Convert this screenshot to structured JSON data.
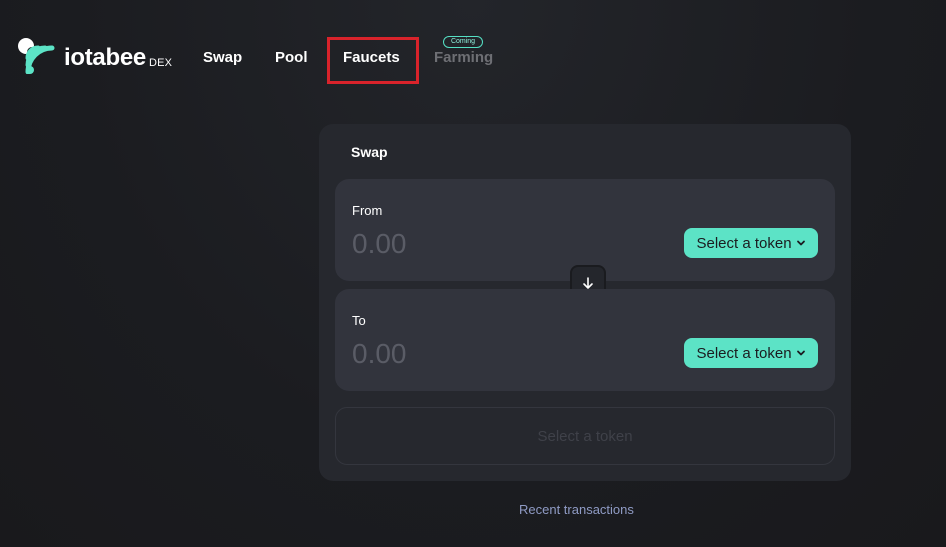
{
  "brand": {
    "name": "iotabee",
    "sub": "DEX",
    "accent": "#5ce3c6"
  },
  "nav": {
    "swap": "Swap",
    "pool": "Pool",
    "faucets": "Faucets",
    "farming": "Farming",
    "farming_badge": "Coming"
  },
  "swap_card": {
    "title": "Swap",
    "from": {
      "label": "From",
      "placeholder": "0.00",
      "token_button": "Select a token"
    },
    "to": {
      "label": "To",
      "placeholder": "0.00",
      "token_button": "Select a token"
    },
    "switch_icon": "arrow-down-icon",
    "submit_label": "Select a token"
  },
  "footer": {
    "recent_transactions": "Recent transactions"
  }
}
